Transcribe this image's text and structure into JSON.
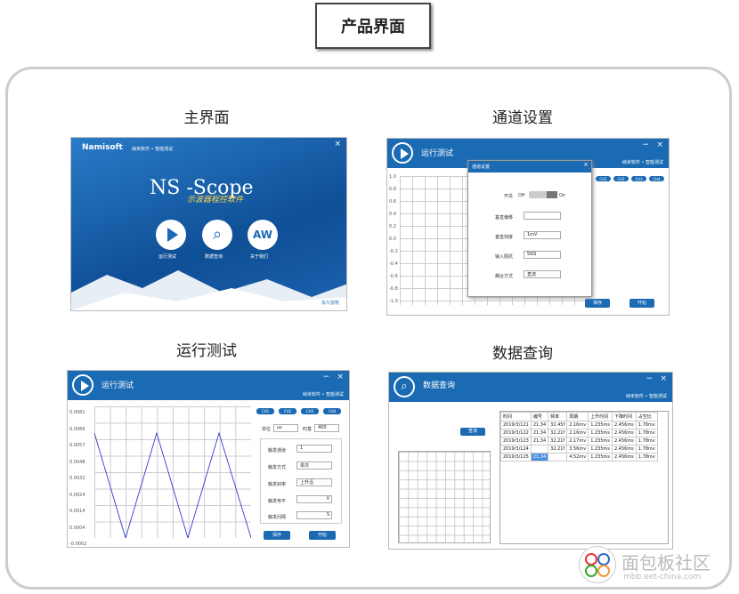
{
  "header": {
    "title": "产品界面"
  },
  "captions": {
    "main": "主界面",
    "channel": "通道设置",
    "run": "运行测试",
    "query": "数据查询"
  },
  "brand": {
    "name": "Namisoft",
    "menu": "纳米软件 • 智能测试",
    "product": "NS -Scope",
    "subtitle": "示波器程控软件"
  },
  "main": {
    "buttons": [
      "运行测试",
      "数据查询",
      "关于我们"
    ],
    "version": "永久授权"
  },
  "channel": {
    "win_title": "运行测试",
    "dialog_title": "通道设置",
    "switch_label": "开关",
    "off": "Off",
    "on": "On",
    "rows": [
      {
        "label": "垂直偏移",
        "value": ""
      },
      {
        "label": "垂直刻度",
        "value": "1mV"
      },
      {
        "label": "输入阻抗",
        "value": "50Ω"
      },
      {
        "label": "耦合方式",
        "value": "直流"
      }
    ]
  },
  "run": {
    "win_title": "运行测试",
    "channels": [
      "CH1",
      "CH2",
      "CH3",
      "CH4"
    ],
    "unit_label": "单位",
    "unit_value": "us",
    "timebase_label": "时基",
    "timebase_value": "400",
    "params": [
      {
        "label": "触发通道",
        "value": "1"
      },
      {
        "label": "触发方式",
        "value": "单次"
      },
      {
        "label": "触发斜率",
        "value": "上升沿"
      },
      {
        "label": "触发电平",
        "value": "V"
      },
      {
        "label": "触发间隔",
        "value": "S"
      }
    ],
    "save_label": "保存",
    "start_label": "开始",
    "y_ticks": [
      "0.0081",
      "0.0066",
      "0.0057",
      "0.0048",
      "0.0032",
      "0.0024",
      "0.0014",
      "0.0004",
      "-0.0002"
    ],
    "y_ticks_small": [
      "1.0",
      "0.8",
      "0.6",
      "0.4",
      "0.2",
      "0.0",
      "-0.2",
      "-0.4",
      "-0.6",
      "-0.8",
      "-1.0"
    ]
  },
  "query": {
    "win_title": "数据查询",
    "query_btn": "查询",
    "columns": [
      "时间",
      "编号",
      "频率",
      "周期",
      "上升时间",
      "下降时间",
      "占空比"
    ],
    "rows": [
      [
        "2019/3/121",
        "21.34",
        "32.45f",
        "2.16mv",
        "1.235ms",
        "2.456ms",
        "1.78mv"
      ],
      [
        "2019/3/122",
        "21.34",
        "32.21f",
        "2.16mv",
        "1.235ms",
        "2.456ms",
        "1.78mv"
      ],
      [
        "2019/3/123",
        "21.34",
        "32.21f",
        "2.17mv",
        "1.235ms",
        "2.456ms",
        "1.78mv"
      ],
      [
        "2019/3/124",
        "",
        "32.21f",
        "3.56mv",
        "1.235ms",
        "2.456ms",
        "1.78mv"
      ],
      [
        "2019/3/125",
        "21.34",
        "",
        "4.52mv",
        "1.235ms",
        "2.456ms",
        "1.78mv"
      ]
    ]
  },
  "watermark": {
    "text": "面包板社区",
    "url": "mbb.eet-china.com"
  },
  "colors": {
    "accent": "#1a6ab4"
  }
}
